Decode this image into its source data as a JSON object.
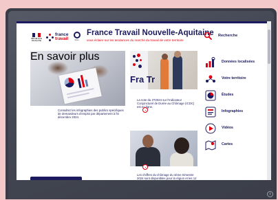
{
  "header": {
    "title": "France Travail Nouvelle-Aquitaine",
    "subtitle": "vous éclaire sur les tendances du marché du travail de votre territoire",
    "logo_republique": "RÉPUBLIQUE FRANÇAISE",
    "logo_brand_line1": "france",
    "logo_brand_line2": "travail",
    "logo_partner": "Opco",
    "search_label": "Recherche"
  },
  "cards": [
    {
      "text": "Consultez les infographies des publics spécifiques de demandeurs d'emploi par département à fin décembre 2024.",
      "button": "En savoir plus"
    },
    {
      "text": "La note du 3T2024 sur l'Indicateur Conjoncturel de Durée au Chômage (ICDC) est en ligne.",
      "image_caption": "Fra Tr"
    },
    {
      "text": "Les chiffres du chômage du 4ème trimestre 2024 sont disponibles pour la région et les 12 départements."
    }
  ],
  "menu": [
    {
      "label": "Données localisées",
      "icon": "map-chart-icon"
    },
    {
      "label": "Votre territoire",
      "icon": "people-network-icon"
    },
    {
      "label": "Études",
      "icon": "pie-chart-icon"
    },
    {
      "label": "Infographies",
      "icon": "infographic-icon"
    },
    {
      "label": "Vidéos",
      "icon": "play-icon"
    },
    {
      "label": "Cartes",
      "icon": "map-pin-icon"
    }
  ],
  "colors": {
    "navy": "#1b1a5e",
    "red": "#e1000f",
    "backdrop": "#f3c9c9"
  }
}
